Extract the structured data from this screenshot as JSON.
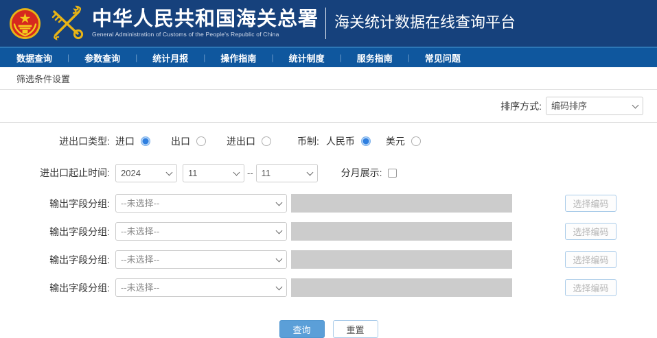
{
  "header": {
    "org_cn": "中华人民共和国海关总署",
    "org_en": "General Administration of Customs of the People's Republic of China",
    "platform": "海关统计数据在线查询平台"
  },
  "nav": {
    "items": [
      "数据查询",
      "参数查询",
      "统计月报",
      "操作指南",
      "统计制度",
      "服务指南",
      "常见问题"
    ]
  },
  "breadcrumb": "筛选条件设置",
  "sort": {
    "label": "排序方式:",
    "value": "编码排序"
  },
  "form": {
    "trade_type": {
      "label": "进出口类型:",
      "options": [
        {
          "label": "进口",
          "selected": true
        },
        {
          "label": "出口",
          "selected": false
        },
        {
          "label": "进出口",
          "selected": false
        }
      ]
    },
    "currency": {
      "label": "币制:",
      "options": [
        {
          "label": "人民币",
          "selected": true
        },
        {
          "label": "美元",
          "selected": false
        }
      ]
    },
    "time_range": {
      "label": "进出口起止时间:",
      "year": "2024",
      "start_month": "11",
      "separator": "--",
      "end_month": "11"
    },
    "monthly": {
      "label": "分月展示:",
      "checked": false
    },
    "field_groups": {
      "label": "输出字段分组:",
      "placeholder": "--未选择--",
      "button": "选择编码"
    },
    "actions": {
      "query": "查询",
      "reset": "重置"
    }
  },
  "colors": {
    "header_bg": "#16417c",
    "nav_bg": "#0f579e",
    "accent_blue": "#2e7fe0",
    "query_btn": "#5b9fd8"
  }
}
